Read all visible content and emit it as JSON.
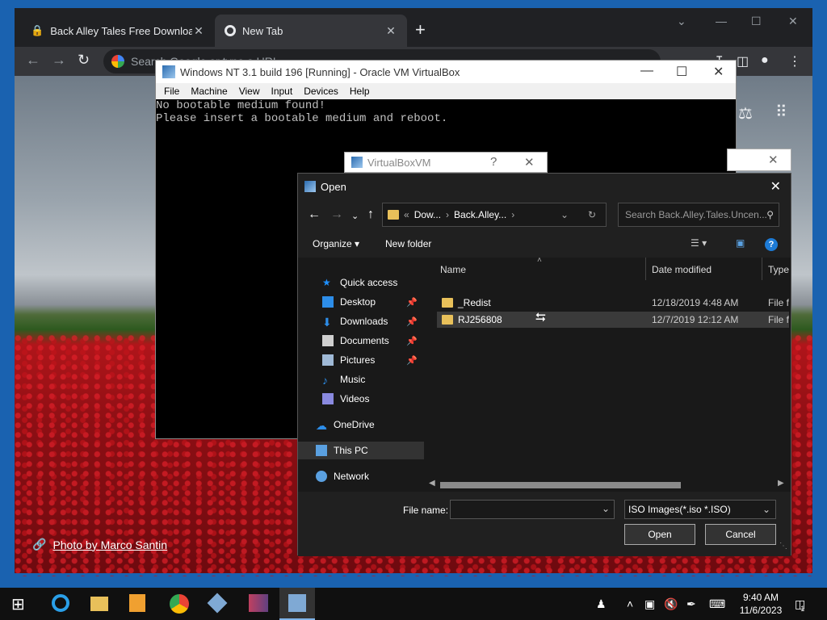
{
  "browser": {
    "tabs": [
      {
        "label": "Back Alley Tales Free Download (",
        "active": false
      },
      {
        "label": "New Tab",
        "active": true
      }
    ],
    "omnibox_placeholder": "Search Google or type a URL",
    "photo_credit": "Photo by Marco Santin"
  },
  "vbox": {
    "title": "Windows NT 3.1 build 196 [Running] - Oracle VM VirtualBox",
    "menu": [
      "File",
      "Machine",
      "View",
      "Input",
      "Devices",
      "Help"
    ],
    "screen_lines": [
      "No bootable medium found!",
      "Please insert a bootable medium and reboot."
    ]
  },
  "vbvm_dialog": {
    "title": "VirtualBoxVM",
    "help": "?"
  },
  "open_dialog": {
    "title": "Open",
    "breadcrumb": [
      "Dow...",
      "Back.Alley..."
    ],
    "search_placeholder": "Search Back.Alley.Tales.Uncen...",
    "organize_label": "Organize",
    "new_folder_label": "New folder",
    "nav": [
      {
        "label": "Quick access",
        "icon": "star-icon",
        "color": "#1e90ff"
      },
      {
        "label": "Desktop",
        "icon": "desktop-icon",
        "color": "#2d8de8",
        "pinned": true
      },
      {
        "label": "Downloads",
        "icon": "download-icon",
        "color": "#2d8de8",
        "pinned": true
      },
      {
        "label": "Documents",
        "icon": "documents-icon",
        "color": "#cfcfcf",
        "pinned": true
      },
      {
        "label": "Pictures",
        "icon": "pictures-icon",
        "color": "#9fb9d6",
        "pinned": true
      },
      {
        "label": "Music",
        "icon": "music-icon",
        "color": "#2d8de8"
      },
      {
        "label": "Videos",
        "icon": "videos-icon",
        "color": "#8a8ae0"
      },
      {
        "label": "OneDrive",
        "icon": "cloud-icon",
        "color": "#2d8de8"
      },
      {
        "label": "This PC",
        "icon": "computer-icon",
        "color": "#5aa0e0"
      },
      {
        "label": "Network",
        "icon": "network-icon",
        "color": "#5aa0e0"
      }
    ],
    "columns": {
      "name": "Name",
      "date": "Date modified",
      "type": "Type"
    },
    "files": [
      {
        "name": "_Redist",
        "date": "12/18/2019 4:48 AM",
        "type": "File fo"
      },
      {
        "name": "RJ256808",
        "date": "12/7/2019 12:12 AM",
        "type": "File fo"
      }
    ],
    "file_name_label": "File name:",
    "file_name_value": "",
    "file_type": "ISO Images(*.iso *.ISO)",
    "open_label": "Open",
    "cancel_label": "Cancel"
  },
  "taskbar": {
    "time": "9:40 AM",
    "date": "11/6/2023",
    "notification_count": "1"
  }
}
